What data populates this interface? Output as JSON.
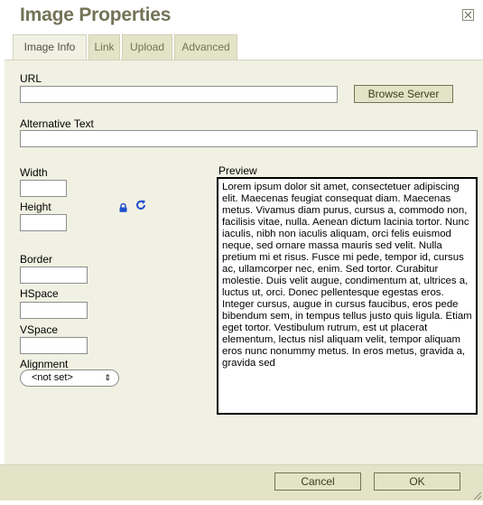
{
  "dialog": {
    "title": "Image Properties",
    "close_icon": "close-icon"
  },
  "tabs": [
    {
      "label": "Image Info",
      "active": true
    },
    {
      "label": "Link",
      "active": false
    },
    {
      "label": "Upload",
      "active": false
    },
    {
      "label": "Advanced",
      "active": false
    }
  ],
  "fields": {
    "url_label": "URL",
    "url_value": "",
    "browse_label": "Browse Server",
    "alt_label": "Alternative Text",
    "alt_value": "",
    "width_label": "Width",
    "width_value": "",
    "height_label": "Height",
    "height_value": "",
    "lock_icon": "lock-icon",
    "reset_icon": "reset-size-icon",
    "border_label": "Border",
    "border_value": "",
    "hspace_label": "HSpace",
    "hspace_value": "",
    "vspace_label": "VSpace",
    "vspace_value": "",
    "alignment_label": "Alignment",
    "alignment_value": "<not set>"
  },
  "preview": {
    "label": "Preview",
    "text": "Lorem ipsum dolor sit amet, consectetuer adipiscing elit. Maecenas feugiat consequat diam. Maecenas metus. Vivamus diam purus, cursus a, commodo non, facilisis vitae, nulla. Aenean dictum lacinia tortor. Nunc iaculis, nibh non iaculis aliquam, orci felis euismod neque, sed ornare massa mauris sed velit. Nulla pretium mi et risus. Fusce mi pede, tempor id, cursus ac, ullamcorper nec, enim. Sed tortor. Curabitur molestie. Duis velit augue, condimentum at, ultrices a, luctus ut, orci. Donec pellentesque egestas eros. Integer cursus, augue in cursus faucibus, eros pede bibendum sem, in tempus tellus justo quis ligula. Etiam eget tortor. Vestibulum rutrum, est ut placerat elementum, lectus nisl aliquam velit, tempor aliquam eros nunc nonummy metus. In eros metus, gravida a, gravida sed"
  },
  "footer": {
    "cancel_label": "Cancel",
    "ok_label": "OK"
  },
  "colors": {
    "title": "#737357",
    "panel": "#f1f1e3",
    "tab": "#e3e3c7",
    "footer": "#e3e3c7",
    "icon_blue": "#1f4ecf"
  }
}
